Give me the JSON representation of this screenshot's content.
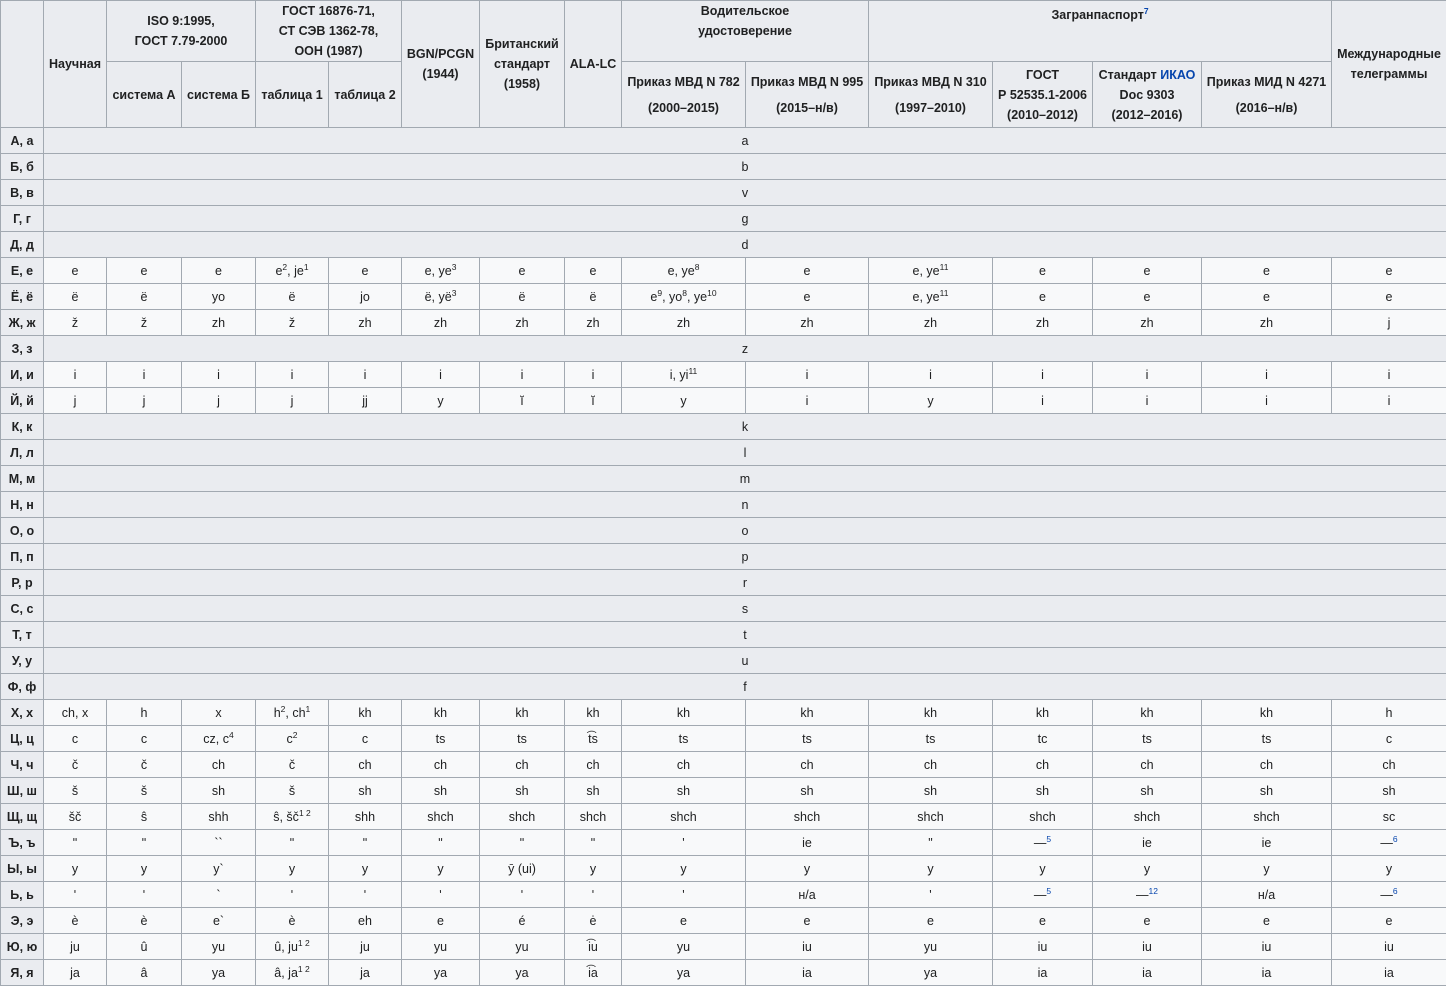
{
  "headers": {
    "group_iso": [
      "ISO 9:1995,",
      "ГОСТ 7.79-2000"
    ],
    "group_gost": [
      "ГОСТ 16876-71,",
      "СТ СЭВ 1362-78,",
      "ООН (1987)"
    ],
    "bgn": [
      "BGN/PCGN",
      "(1944)"
    ],
    "british": [
      "Британский",
      "стандарт",
      "(1958)"
    ],
    "alalc": "ALA-LC",
    "group_driver": [
      "Водительское",
      "удостоверение"
    ],
    "group_passport": "Загранпаспорт",
    "group_passport_note": "7",
    "telegrams": [
      "Международные",
      "телеграммы"
    ],
    "scientific": "Научная",
    "iso_a": "система А",
    "iso_b": "система Б",
    "gost_t1": "таблица 1",
    "gost_t2": "таблица 2",
    "drv_782": [
      "Приказ МВД N 782",
      "(2000–2015)"
    ],
    "drv_995": [
      "Приказ МВД N 995",
      "(2015–н/в)"
    ],
    "pas_310": [
      "Приказ МВД N 310",
      "(1997–2010)"
    ],
    "pas_gost": [
      "ГОСТ",
      "Р 52535.1-2006",
      "(2010–2012)"
    ],
    "pas_icao_prefix": "Стандарт ",
    "pas_icao_link": "ИКАО",
    "pas_icao_rest": [
      "Doc 9303",
      "(2012–2016)"
    ],
    "pas_4271": [
      "Приказ МИД N 4271",
      "(2016–н/в)"
    ]
  },
  "rows": [
    {
      "letter": "А, а",
      "span": "a"
    },
    {
      "letter": "Б, б",
      "span": "b"
    },
    {
      "letter": "В, в",
      "span": "v"
    },
    {
      "letter": "Г, г",
      "span": "g"
    },
    {
      "letter": "Д, д",
      "span": "d"
    },
    {
      "letter": "Е, е",
      "cells": [
        "e",
        "e",
        "e",
        "e^2, je^1",
        "e",
        "e, ye^3",
        "e",
        "e",
        "e, ye^8",
        "e",
        "e, ye^11",
        "e",
        "e",
        "e",
        "e"
      ]
    },
    {
      "letter": "Ё, ё",
      "cells": [
        "ë",
        "ë",
        "yo",
        "ë",
        "jo",
        "ë, yë^3",
        "ë",
        "ë",
        "e^9, yo^8, ye^10",
        "e",
        "e, ye^11",
        "e",
        "e",
        "e",
        "e"
      ]
    },
    {
      "letter": "Ж, ж",
      "cells": [
        "ž",
        "ž",
        "zh",
        "ž",
        "zh",
        "zh",
        "zh",
        "zh",
        "zh",
        "zh",
        "zh",
        "zh",
        "zh",
        "zh",
        "j"
      ]
    },
    {
      "letter": "З, з",
      "span": "z"
    },
    {
      "letter": "И, и",
      "cells": [
        "i",
        "i",
        "i",
        "i",
        "i",
        "i",
        "i",
        "i",
        "i, yi^11",
        "i",
        "i",
        "i",
        "i",
        "i",
        "i"
      ]
    },
    {
      "letter": "Й, й",
      "cells": [
        "j",
        "j",
        "j",
        "j",
        "jj",
        "y",
        "ĭ",
        "ĭ",
        "y",
        "i",
        "y",
        "i",
        "i",
        "i",
        "i"
      ]
    },
    {
      "letter": "К, к",
      "span": "k"
    },
    {
      "letter": "Л, л",
      "span": "l"
    },
    {
      "letter": "М, м",
      "span": "m"
    },
    {
      "letter": "Н, н",
      "span": "n"
    },
    {
      "letter": "О, о",
      "span": "o"
    },
    {
      "letter": "П, п",
      "span": "p"
    },
    {
      "letter": "Р, р",
      "span": "r"
    },
    {
      "letter": "С, с",
      "span": "s"
    },
    {
      "letter": "Т, т",
      "span": "t"
    },
    {
      "letter": "У, у",
      "span": "u"
    },
    {
      "letter": "Ф, ф",
      "span": "f"
    },
    {
      "letter": "Х, х",
      "cells": [
        "ch, x",
        "h",
        "x",
        "h^2, ch^1",
        "kh",
        "kh",
        "kh",
        "kh",
        "kh",
        "kh",
        "kh",
        "kh",
        "kh",
        "kh",
        "h"
      ]
    },
    {
      "letter": "Ц, ц",
      "cells": [
        "c",
        "c",
        "cz, c^4",
        "c^2",
        "c",
        "ts",
        "ts",
        "t͡s",
        "ts",
        "ts",
        "ts",
        "tc",
        "ts",
        "ts",
        "c"
      ]
    },
    {
      "letter": "Ч, ч",
      "cells": [
        "č",
        "č",
        "ch",
        "č",
        "ch",
        "ch",
        "ch",
        "ch",
        "ch",
        "ch",
        "ch",
        "ch",
        "ch",
        "ch",
        "ch"
      ]
    },
    {
      "letter": "Ш, ш",
      "cells": [
        "š",
        "š",
        "sh",
        "š",
        "sh",
        "sh",
        "sh",
        "sh",
        "sh",
        "sh",
        "sh",
        "sh",
        "sh",
        "sh",
        "sh"
      ]
    },
    {
      "letter": "Щ, щ",
      "cells": [
        "šč",
        "ŝ",
        "shh",
        "ŝ, šč^1 2",
        "shh",
        "shch",
        "shch",
        "shch",
        "shch",
        "shch",
        "shch",
        "shch",
        "shch",
        "shch",
        "sc"
      ]
    },
    {
      "letter": "Ъ, ъ",
      "cells": [
        "ʺ",
        "ʺ",
        "``",
        "ʺ",
        "ʺ",
        "ʺ",
        "ʺ",
        "ʺ",
        "'",
        "ie",
        "\"",
        "—^5",
        "ie",
        "ie",
        "—^6"
      ]
    },
    {
      "letter": "Ы, ы",
      "cells": [
        "y",
        "y",
        "y`",
        "y",
        "y",
        "y",
        "ȳ (ui)",
        "y",
        "y",
        "y",
        "y",
        "y",
        "y",
        "y",
        "y"
      ]
    },
    {
      "letter": "Ь, ь",
      "cells": [
        "ʹ",
        "ʹ",
        "`",
        "ʹ",
        "ʹ",
        "ʹ",
        "ʹ",
        "ʹ",
        "'",
        "н/а",
        "'",
        "—^5",
        "—^12",
        "н/а",
        "—^6"
      ]
    },
    {
      "letter": "Э, э",
      "cells": [
        "è",
        "è",
        "e`",
        "è",
        "eh",
        "e",
        "é",
        "ė",
        "e",
        "e",
        "e",
        "e",
        "e",
        "e",
        "e"
      ]
    },
    {
      "letter": "Ю, ю",
      "cells": [
        "ju",
        "û",
        "yu",
        "û, ju^1 2",
        "ju",
        "yu",
        "yu",
        "i͡u",
        "yu",
        "iu",
        "yu",
        "iu",
        "iu",
        "iu",
        "iu"
      ]
    },
    {
      "letter": "Я, я",
      "cells": [
        "ja",
        "â",
        "ya",
        "â, ja^1 2",
        "ja",
        "ya",
        "ya",
        "i͡a",
        "ya",
        "ia",
        "ya",
        "ia",
        "ia",
        "ia",
        "ia"
      ]
    }
  ]
}
